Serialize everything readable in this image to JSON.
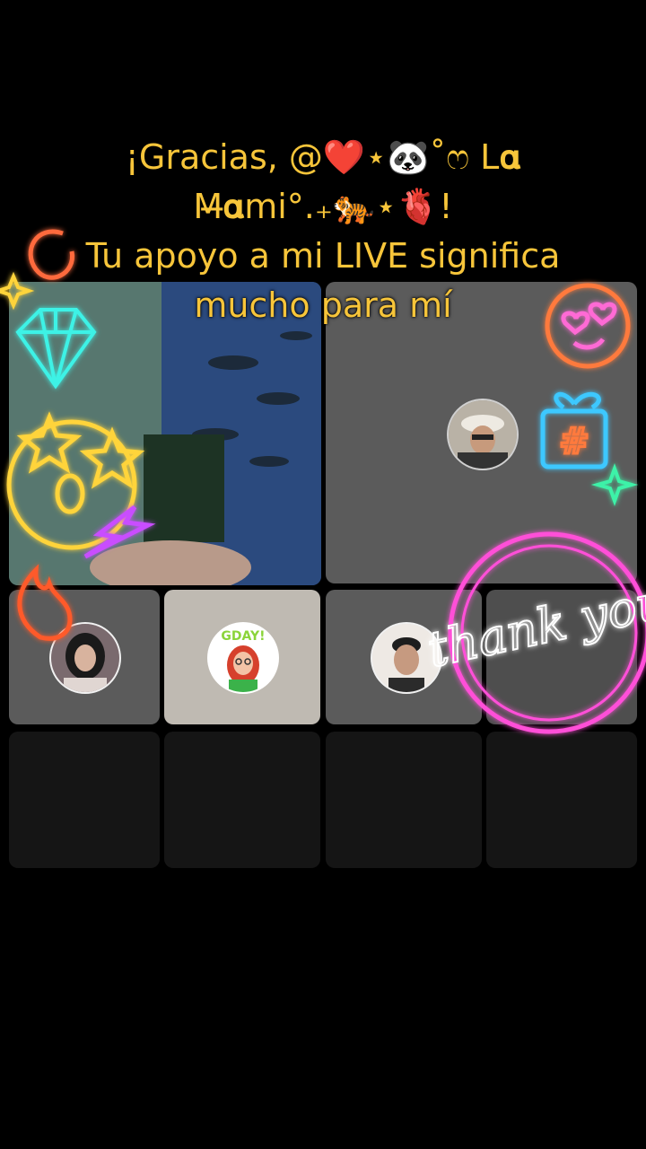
{
  "banner": {
    "line1": "¡Gracias, @❤️⋆🐼˚ෆ L𝛂",
    "line2": "M̶𝛂mi°.₊🐅⋆🫀!",
    "line3": "Tu apoyo a mi LIVE significa",
    "line4": "mucho para mí"
  },
  "stickers": {
    "thank_you": "thank you",
    "hash": "#"
  },
  "colors": {
    "banner_text": "#f7c53a",
    "neon_pink": "#ff4fd8",
    "neon_cyan": "#3ef2e6",
    "neon_yellow": "#ffd43b",
    "neon_orange": "#ff6a3d"
  },
  "icons": [
    "diamond-icon",
    "star-eyes-emoji-icon",
    "fire-icon",
    "heart-eyes-emoji-icon",
    "gift-icon",
    "sparkle-icon",
    "lightning-icon",
    "swirl-icon"
  ]
}
